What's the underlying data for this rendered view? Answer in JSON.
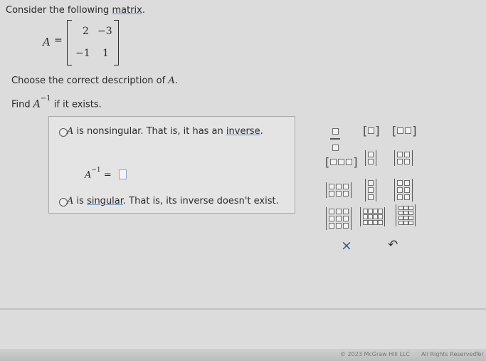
{
  "question": {
    "prompt_text": "Consider the following",
    "prompt_link": "matrix",
    "prompt_end": ".",
    "matrix_name": "A",
    "equals": "=",
    "matrix": [
      [
        "2",
        "−3"
      ],
      [
        "−1",
        "1"
      ]
    ],
    "instruction": "Choose the correct description of",
    "instruction_var": "A",
    "instruction_end": ".",
    "find_prefix": "Find",
    "find_var": "A",
    "find_exp": "−1",
    "find_suffix": "if it exists."
  },
  "options": {
    "nonsingular_var": "A",
    "nonsingular_text": " is nonsingular. That is, it has an",
    "nonsingular_link": "inverse",
    "nonsingular_end": ".",
    "inverse_var": "A",
    "inverse_exp": "−1",
    "inverse_eq": "=",
    "singular_var": "A",
    "singular_pre": " is",
    "singular_link": "singular",
    "singular_post": ". That is, its inverse doesn't exist."
  },
  "toolbar": {
    "clear_symbol": "×",
    "undo_symbol": "↶"
  },
  "footer": {
    "copyright": "© 2023 McGraw Hill LLC",
    "rights": "All Rights Reserved",
    "terms": "Ter"
  }
}
